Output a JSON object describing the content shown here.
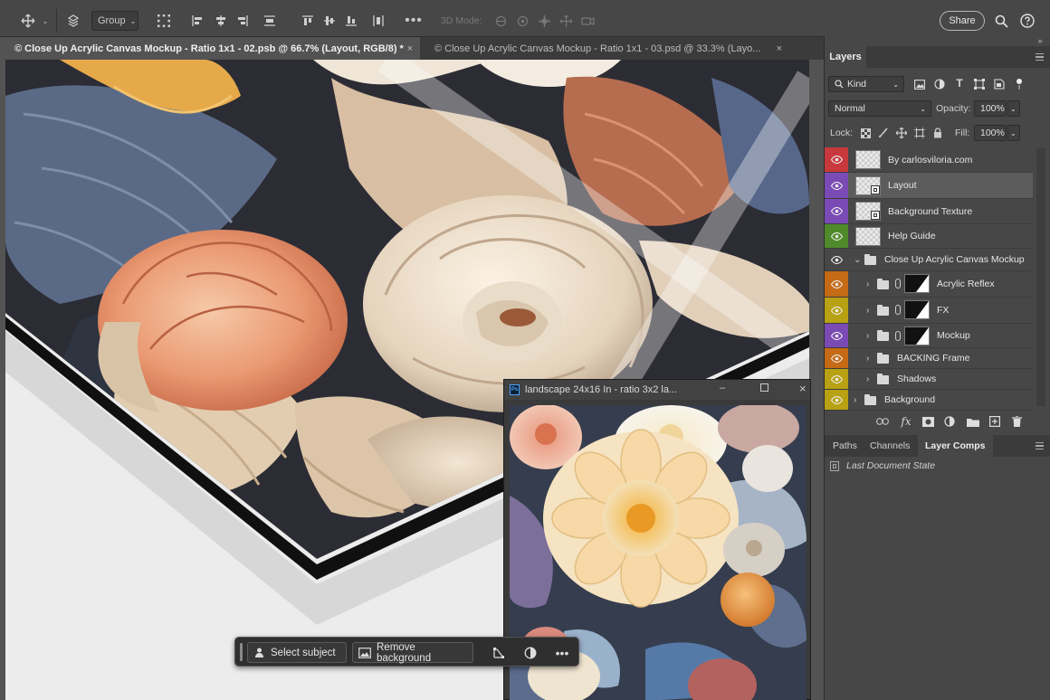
{
  "options_bar": {
    "group_select_value": "Group",
    "mode_3d_label": "3D Mode:",
    "share_label": "Share"
  },
  "tabs": [
    {
      "label": "© Close Up Acrylic Canvas Mockup - Ratio 1x1 - 02.psb @ 66.7% (Layout, RGB/8) *"
    },
    {
      "label": "© Close Up Acrylic Canvas Mockup - Ratio 1x1 - 03.psd @ 33.3% (Layo..."
    }
  ],
  "floating_doc": {
    "title": "landscape 24x16 In - ratio 3x2 la..."
  },
  "task_bar": {
    "select_subject": "Select subject",
    "remove_background": "Remove background"
  },
  "layers_panel": {
    "title": "Layers",
    "filter_kind": "Kind",
    "blend_mode": "Normal",
    "opacity_label": "Opacity:",
    "opacity_value": "100%",
    "lock_label": "Lock:",
    "fill_label": "Fill:",
    "fill_value": "100%",
    "layers": [
      {
        "name": "By carlosviloria.com",
        "color": "#c8393d",
        "kind": "layer"
      },
      {
        "name": "Layout",
        "color": "#7b4bb5",
        "kind": "smart",
        "selected": true
      },
      {
        "name": "Background Texture",
        "color": "#7b4bb5",
        "kind": "smart"
      },
      {
        "name": "Help Guide",
        "color": "#4f8a2a",
        "kind": "layer"
      },
      {
        "name": "Close Up Acrylic Canvas Mockup",
        "color": "",
        "kind": "group-open"
      },
      {
        "name": "Acrylic Reflex",
        "color": "#c56a15",
        "kind": "group-mask"
      },
      {
        "name": "FX",
        "color": "#b8a112",
        "kind": "group-mask"
      },
      {
        "name": "Mockup",
        "color": "#7b4bb5",
        "kind": "group-mask"
      },
      {
        "name": "BACKING Frame",
        "color": "#c56a15",
        "kind": "group"
      },
      {
        "name": "Shadows",
        "color": "#b8a112",
        "kind": "group"
      },
      {
        "name": "Background",
        "color": "#b8a112",
        "kind": "group-top"
      }
    ]
  },
  "bottom_panel": {
    "tabs": [
      "Paths",
      "Channels",
      "Layer Comps"
    ],
    "active_tab": "Layer Comps",
    "comp_state": "Last Document State"
  }
}
